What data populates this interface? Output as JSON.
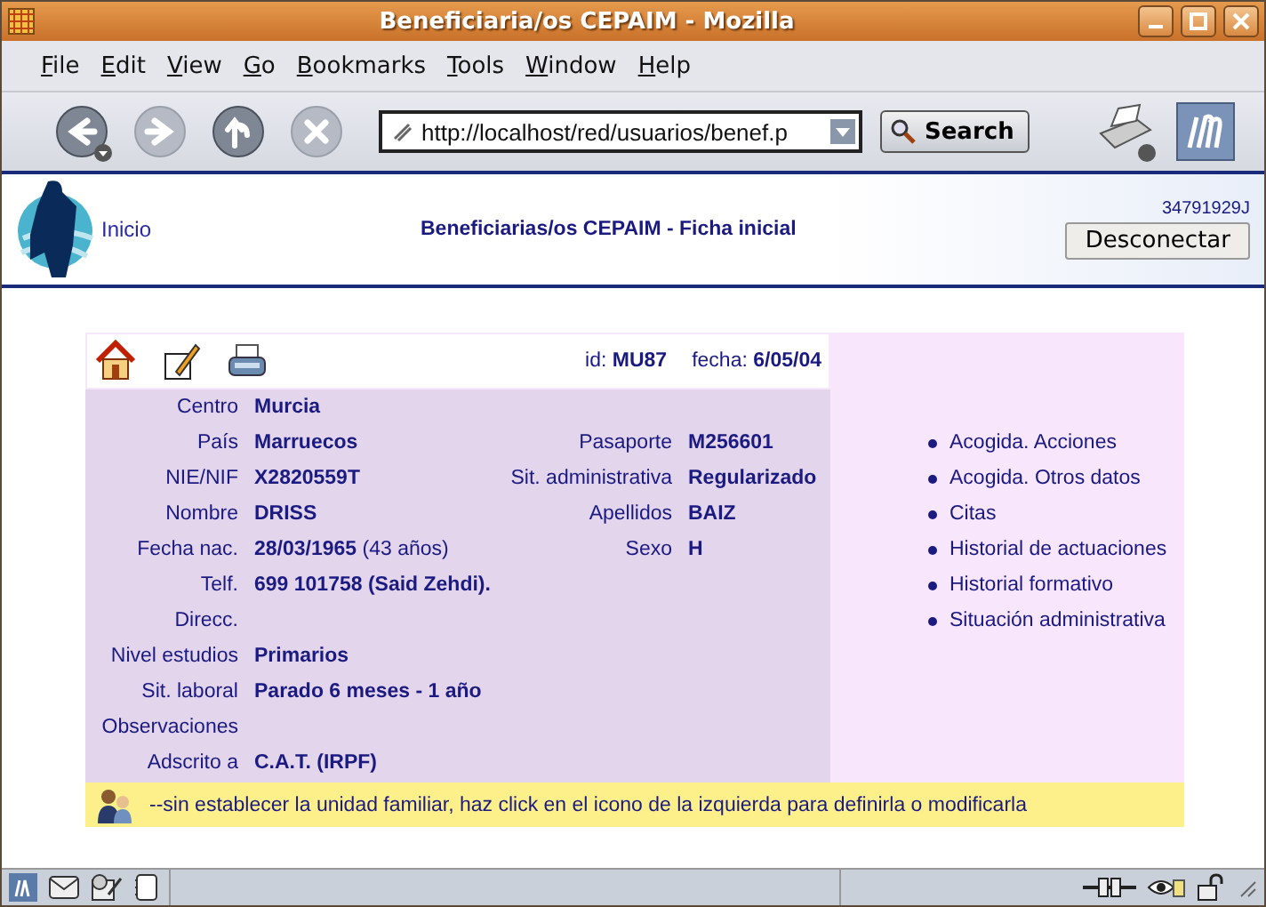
{
  "window": {
    "title": "Beneficiaria/os CEPAIM - Mozilla"
  },
  "menu": [
    "File",
    "Edit",
    "View",
    "Go",
    "Bookmarks",
    "Tools",
    "Window",
    "Help"
  ],
  "toolbar": {
    "nav_buttons": [
      {
        "kind": "back",
        "disabled": false
      },
      {
        "kind": "forward",
        "disabled": true
      },
      {
        "kind": "reload",
        "disabled": false
      },
      {
        "kind": "stop",
        "disabled": true
      }
    ],
    "url": "http://localhost/red/usuarios/benef.p",
    "search_label": "Search"
  },
  "header": {
    "home_link": "Inicio",
    "title": "Beneficiarias/os CEPAIM - Ficha inicial",
    "user_code": "34791929J",
    "logout": "Desconectar"
  },
  "record": {
    "id_label": "id:",
    "id": "MU87",
    "date_label": "fecha:",
    "date": "6/05/04",
    "rows": [
      {
        "label": "Centro",
        "value": "Murcia"
      },
      {
        "label": "País",
        "value": "Marruecos",
        "right_label": "Pasaporte",
        "right_value": "M256601"
      },
      {
        "label": "NIE/NIF",
        "value": "X2820559T",
        "right_label": "Sit. administrativa",
        "right_value": "Regularizado"
      },
      {
        "label": "Nombre",
        "value": "DRISS",
        "right_label": "Apellidos",
        "right_value": "BAIZ"
      },
      {
        "label": "Fecha nac.",
        "value": "28/03/1965",
        "note": "(43 años)",
        "right_label": "Sexo",
        "right_value": "H"
      },
      {
        "label": "Telf.",
        "value": "699 101758 (Said Zehdi)."
      },
      {
        "label": "Direcc."
      },
      {
        "label": "Nivel estudios",
        "value": "Primarios"
      },
      {
        "label": "Sit. laboral",
        "value": "Parado 6 meses - 1 año"
      },
      {
        "label": "Observaciones"
      },
      {
        "label": "Adscrito a",
        "value": "C.A.T. (IRPF)"
      }
    ],
    "notice": "--sin establecer la unidad familiar, haz click en el icono de la izquierda para definirla o modificarla"
  },
  "links": [
    "Acogida. Acciones",
    "Acogida. Otros datos",
    "Citas",
    "Historial de actuaciones",
    "Historial formativo",
    "Situación administrativa"
  ]
}
